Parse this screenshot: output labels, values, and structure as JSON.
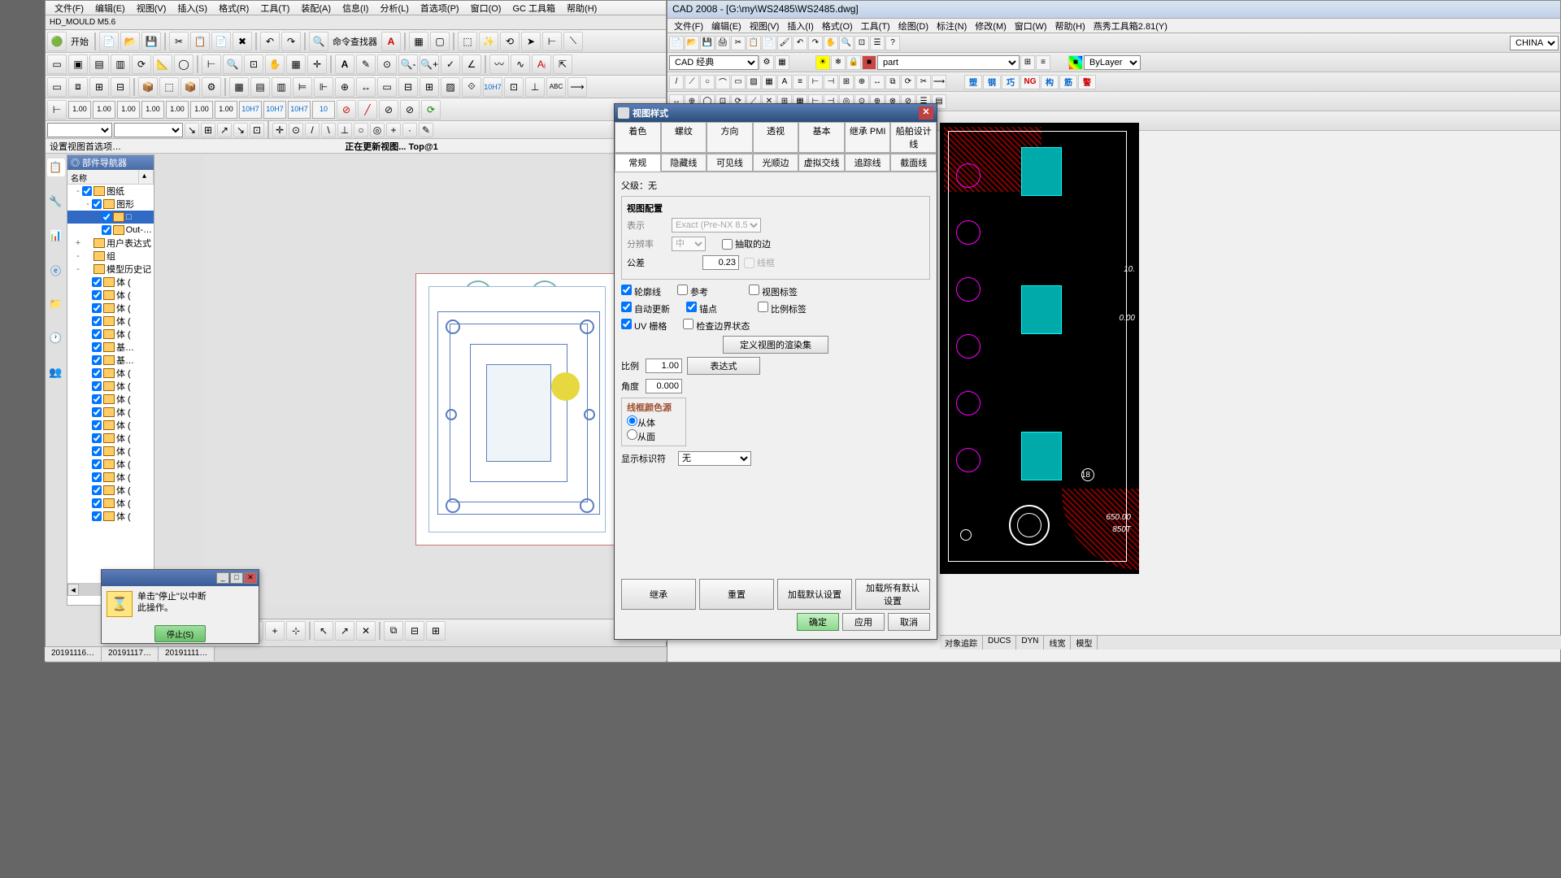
{
  "left_app": {
    "menu": [
      "文件(F)",
      "编辑(E)",
      "视图(V)",
      "插入(S)",
      "格式(R)",
      "工具(T)",
      "装配(A)",
      "信息(I)",
      "分析(L)",
      "首选项(P)",
      "窗口(O)",
      "GC 工具箱",
      "帮助(H)"
    ],
    "extra_menu": "HD_MOULD M5.6",
    "cmd_finder": "命令查找器",
    "start": "开始",
    "info_left": "设置视图首选项…",
    "info_center": "正在更新视图... Top@1",
    "nav_title": "◎ 部件导航器",
    "nav_col1": "名称",
    "tree": [
      {
        "lvl": 1,
        "exp": "-",
        "chk": true,
        "txt": "图纸"
      },
      {
        "lvl": 2,
        "exp": "-",
        "chk": true,
        "txt": "图形"
      },
      {
        "lvl": 3,
        "exp": "",
        "chk": true,
        "txt": "□",
        "sel": true
      },
      {
        "lvl": 3,
        "exp": "",
        "chk": true,
        "txt": "Out-…"
      },
      {
        "lvl": 1,
        "exp": "+",
        "chk": false,
        "txt": "用户表达式"
      },
      {
        "lvl": 1,
        "exp": "-",
        "chk": false,
        "txt": "组"
      },
      {
        "lvl": 1,
        "exp": "-",
        "chk": false,
        "txt": "模型历史记"
      },
      {
        "lvl": 2,
        "exp": "",
        "chk": true,
        "txt": "体  ("
      },
      {
        "lvl": 2,
        "exp": "",
        "chk": true,
        "txt": "体  ("
      },
      {
        "lvl": 2,
        "exp": "",
        "chk": true,
        "txt": "体  ("
      },
      {
        "lvl": 2,
        "exp": "",
        "chk": true,
        "txt": "体  ("
      },
      {
        "lvl": 2,
        "exp": "",
        "chk": true,
        "txt": "体  ("
      },
      {
        "lvl": 2,
        "exp": "",
        "chk": true,
        "txt": "基…"
      },
      {
        "lvl": 2,
        "exp": "",
        "chk": true,
        "txt": "基…"
      },
      {
        "lvl": 2,
        "exp": "",
        "chk": true,
        "txt": "体  ("
      },
      {
        "lvl": 2,
        "exp": "",
        "chk": true,
        "txt": "体  ("
      },
      {
        "lvl": 2,
        "exp": "",
        "chk": true,
        "txt": "体  ("
      },
      {
        "lvl": 2,
        "exp": "",
        "chk": true,
        "txt": "体  ("
      },
      {
        "lvl": 2,
        "exp": "",
        "chk": true,
        "txt": "体  ("
      },
      {
        "lvl": 2,
        "exp": "",
        "chk": true,
        "txt": "体  ("
      },
      {
        "lvl": 2,
        "exp": "",
        "chk": true,
        "txt": "体  ("
      },
      {
        "lvl": 2,
        "exp": "",
        "chk": true,
        "txt": "体  ("
      },
      {
        "lvl": 2,
        "exp": "",
        "chk": true,
        "txt": "体  ("
      },
      {
        "lvl": 2,
        "exp": "",
        "chk": true,
        "txt": "体  ("
      },
      {
        "lvl": 2,
        "exp": "",
        "chk": true,
        "txt": "体  ("
      },
      {
        "lvl": 2,
        "exp": "",
        "chk": true,
        "txt": "体  ("
      }
    ],
    "dim_labels": [
      "1.00",
      "1.00",
      "1.00",
      "1.00",
      "1.00",
      "1.00",
      "1.00",
      "10H7",
      "10H7",
      "10H7",
      "10"
    ],
    "status_tabs": [
      "20191116…",
      "20191117…",
      "20191111…"
    ]
  },
  "progress": {
    "text1": "单击\"停止\"以中断",
    "text2": "此操作。",
    "button": "停止(S)"
  },
  "view_dialog": {
    "title": "视图样式",
    "tabs_row1": [
      "着色",
      "螺纹",
      "方向",
      "透视",
      "基本",
      "继承 PMI",
      "船舶设计线"
    ],
    "tabs_row2": [
      "常规",
      "隐藏线",
      "可见线",
      "光顺边",
      "虚拟交线",
      "追踪线",
      "截面线"
    ],
    "active_tab": "常规",
    "parent": "父级：无",
    "group_title": "视图配置",
    "display_label": "表示",
    "display_value": "Exact (Pre-NX 8.5)",
    "res_label": "分辨率",
    "res_value": "中",
    "extract_edges": "抽取的边",
    "tolerance_label": "公差",
    "tolerance_value": "0.23",
    "wireframe_opt": "线框",
    "chk_silhouette": "轮廓线",
    "chk_reference": "参考",
    "chk_viewlabel": "视图标签",
    "chk_autoupdate": "自动更新",
    "chk_anchor": "锚点",
    "chk_scalelabel": "比例标签",
    "chk_uvgrid": "UV  栅格",
    "chk_boundary": "检查边界状态",
    "btn_define_render": "定义视图的渲染集",
    "scale_label": "比例",
    "scale_value": "1.00",
    "btn_expression": "表达式",
    "angle_label": "角度",
    "angle_value": "0.000",
    "wire_color_group": "线框颜色源",
    "radio_from_body": "从体",
    "radio_from_face": "从面",
    "marker_label": "显示标识符",
    "marker_value": "无",
    "btn_inherit": "继承",
    "btn_reset": "重置",
    "btn_load_default": "加载默认设置",
    "btn_load_all_default": "加载所有默认设置",
    "btn_ok": "确定",
    "btn_apply": "应用",
    "btn_cancel": "取消"
  },
  "right_app": {
    "title": "CAD 2008 - [G:\\my\\WS2485\\WS2485.dwg]",
    "menu": [
      "文件(F)",
      "编辑(E)",
      "视图(V)",
      "插入(I)",
      "格式(O)",
      "工具(T)",
      "绘图(D)",
      "标注(N)",
      "修改(M)",
      "窗口(W)",
      "帮助(H)",
      "燕秀工具箱2.81(Y)"
    ],
    "style": "CAD 经典",
    "layer": "part",
    "bylayer": "ByLayer",
    "right_combo": "CHINA",
    "text_btns": [
      "塑",
      "钢",
      "巧",
      "NG",
      "构",
      "筋",
      "警"
    ],
    "dims": {
      "d1": "10.",
      "d2": "0.00",
      "d3": "650.00",
      "d4": "850T",
      "d5": "18"
    },
    "status": [
      "对象追踪",
      "DUCS",
      "DYN",
      "线宽",
      "模型"
    ]
  }
}
